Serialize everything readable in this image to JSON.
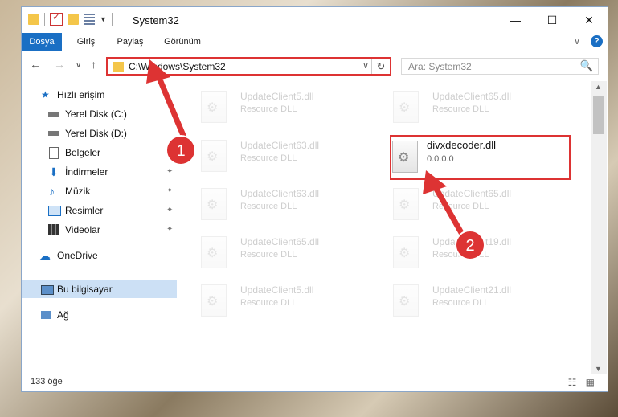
{
  "window": {
    "title": "System32",
    "minimize": "—",
    "maximize": "☐",
    "close": "✕"
  },
  "ribbon": {
    "tabs": [
      "Dosya",
      "Giriş",
      "Paylaş",
      "Görünüm"
    ],
    "expand": "∨",
    "help": "?"
  },
  "nav": {
    "back": "←",
    "forward": "→",
    "recent": "∨",
    "up": "↑",
    "address": "C:\\Windows\\System32",
    "dropdown": "∨",
    "refresh": "↻",
    "search_placeholder": "Ara: System32",
    "search_icon": "🔍"
  },
  "sidebar": {
    "quick_access": "Hızlı erişim",
    "items": [
      {
        "label": "Yerel Disk (C:)",
        "icon": "drive-icon"
      },
      {
        "label": "Yerel Disk (D:)",
        "icon": "drive-icon"
      },
      {
        "label": "Belgeler",
        "icon": "documents-icon"
      },
      {
        "label": "İndirmeler",
        "icon": "download-icon"
      },
      {
        "label": "Müzik",
        "icon": "music-icon"
      },
      {
        "label": "Resimler",
        "icon": "pictures-icon"
      },
      {
        "label": "Videolar",
        "icon": "videos-icon"
      }
    ],
    "onedrive": "OneDrive",
    "this_pc": "Bu bilgisayar",
    "network": "Ağ",
    "pin": "📌"
  },
  "files": [
    {
      "name": "UpdateClient5.dll",
      "desc": "Resource DLL"
    },
    {
      "name": "UpdateClient65.dll",
      "desc": "Resource DLL"
    },
    {
      "name": "UpdateClient63.dll",
      "desc": "Resource DLL"
    },
    {
      "name": "UpdateClient63.dll",
      "desc": "Resource DLL"
    },
    {
      "name": "UpdateClient65.dll",
      "desc": "Resource DLL"
    },
    {
      "name": "UpdateClient65.dll",
      "desc": "Resource DLL"
    },
    {
      "name": "UpdateClient19.dll",
      "desc": "Resource DLL"
    },
    {
      "name": "UpdateClient5.dll",
      "desc": "Resource DLL"
    },
    {
      "name": "UpdateClient21.dll",
      "desc": "Resource DLL"
    }
  ],
  "highlighted_file": {
    "name": "divxdecoder.dll",
    "version": "0.0.0.0"
  },
  "status": {
    "count": "133 öğe",
    "views": "☷ ▦"
  },
  "annotations": {
    "step1": "1",
    "step2": "2"
  },
  "colors": {
    "accent": "#1a6fc4",
    "highlight": "#d33333",
    "selected": "#cce0f5"
  }
}
